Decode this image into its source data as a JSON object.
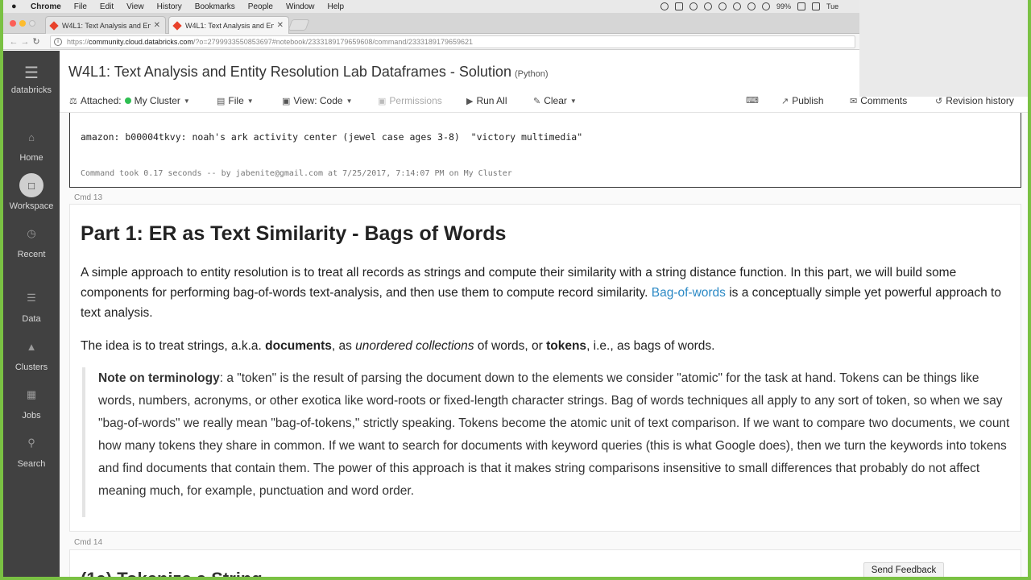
{
  "menubar": {
    "app": "Chrome",
    "items": [
      "File",
      "Edit",
      "View",
      "History",
      "Bookmarks",
      "People",
      "Window",
      "Help"
    ],
    "battery": "99%",
    "clock": "Tue"
  },
  "tabs": [
    {
      "label": "W4L1: Text Analysis and Entity",
      "active": false
    },
    {
      "label": "W4L1: Text Analysis and Entity",
      "active": true
    }
  ],
  "address": {
    "scheme": "https://",
    "host": "community.cloud.databricks.com",
    "path": "/?o=2799933550853697#notebook/2333189179659608/command/2333189179659621"
  },
  "sidebar": {
    "logo_label": "databricks",
    "items": [
      {
        "label": "Home",
        "icon": "home-icon"
      },
      {
        "label": "Workspace",
        "icon": "folder-icon"
      },
      {
        "label": "Recent",
        "icon": "clock-icon"
      },
      {
        "label": "Data",
        "icon": "database-icon"
      },
      {
        "label": "Clusters",
        "icon": "clusters-icon"
      },
      {
        "label": "Jobs",
        "icon": "calendar-icon"
      },
      {
        "label": "Search",
        "icon": "search-icon"
      }
    ]
  },
  "notebook": {
    "title": "W4L1: Text Analysis and Entity Resolution Lab Dataframes - Solution",
    "language": "(Python)"
  },
  "toolbar": {
    "attached_label": "Attached:",
    "cluster": "My Cluster",
    "file": "File",
    "view": "View: Code",
    "permissions": "Permissions",
    "run_all": "Run All",
    "clear": "Clear",
    "publish": "Publish",
    "comments": "Comments",
    "revision_history": "Revision history"
  },
  "output_cell": {
    "line": "amazon: b00004tkvy: noah's ark activity center (jewel case ages 3-8)  \"victory multimedia\"",
    "meta": "Command took 0.17 seconds -- by jabenite@gmail.com at 7/25/2017, 7:14:07 PM on My Cluster"
  },
  "cmd13": "Cmd 13",
  "cmd14": "Cmd 14",
  "markdown": {
    "heading": "Part 1: ER as Text Similarity - Bags of Words",
    "p1_a": "A simple approach to entity resolution is to treat all records as strings and compute their similarity with a string distance function. In this part, we will build some components for performing bag-of-words text-analysis, and then use them to compute record similarity. ",
    "p1_link": "Bag-of-words",
    "p1_b": " is a conceptually simple yet powerful approach to text analysis.",
    "p2_a": "The idea is to treat strings, a.k.a. ",
    "p2_b": "documents",
    "p2_c": ", as ",
    "p2_d": "unordered collections",
    "p2_e": " of words, or ",
    "p2_f": "tokens",
    "p2_g": ", i.e., as bags of words.",
    "note_title": "Note on terminology",
    "note_text": ": a \"token\" is the result of parsing the document down to the elements we consider \"atomic\" for the task at hand. Tokens can be things like words, numbers, acronyms, or other exotica like word-roots or fixed-length character strings. Bag of words techniques all apply to any sort of token, so when we say \"bag-of-words\" we really mean \"bag-of-tokens,\" strictly speaking. Tokens become the atomic unit of text comparison. If we want to compare two documents, we count how many tokens they share in common. If we want to search for documents with keyword queries (this is what Google does), then we turn the keywords into tokens and find documents that contain them. The power of this approach is that it makes string comparisons insensitive to small differences that probably do not affect meaning much, for example, punctuation and word order."
  },
  "next_heading": "(1a) Tokenize a String",
  "feedback": "Send Feedback"
}
